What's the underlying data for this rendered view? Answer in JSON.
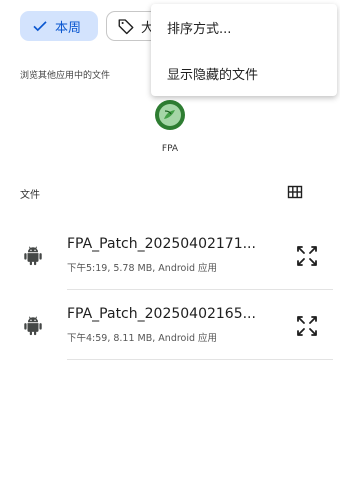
{
  "filters": {
    "this_week_label": "本周",
    "second_chip_label": "大"
  },
  "browse_caption": "浏览其他应用中的文件",
  "recent_apps": [
    {
      "label": "FPA"
    }
  ],
  "files_section": {
    "header": "文件"
  },
  "files": [
    {
      "name": "FPA_Patch_20250402171...",
      "meta": "下午5:19, 5.78 MB, Android 应用"
    },
    {
      "name": "FPA_Patch_20250402165...",
      "meta": "下午4:59, 8.11 MB, Android 应用"
    }
  ],
  "menu": {
    "items": [
      "排序方式...",
      "显示隐藏的文件"
    ]
  },
  "colors": {
    "chip_selected_bg": "#d3e3fd",
    "chip_selected_fg": "#0b57d0",
    "android_icon": "#444746"
  }
}
